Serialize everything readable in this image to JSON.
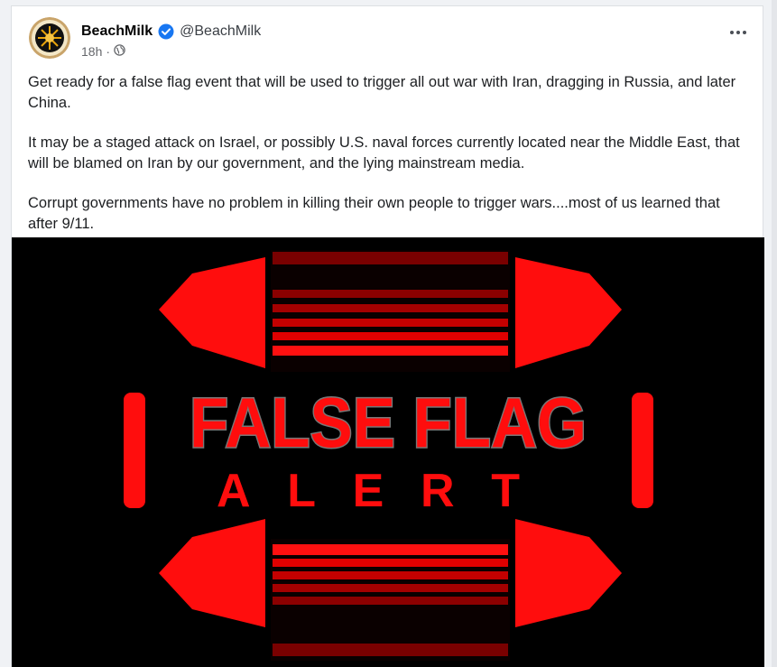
{
  "post": {
    "author": {
      "name": "BeachMilk",
      "handle": "@BeachMilk",
      "verified": true
    },
    "time": "18h",
    "separator": "·",
    "audience_icon": "globe-icon",
    "more_icon": "more-options-icon",
    "paragraphs": [
      "Get ready for a false flag event that will be used to trigger all out war with Iran, dragging in Russia, and later China.",
      "It may be a staged attack on Israel, or possibly U.S. naval forces currently located near the Middle East, that will be blamed on Iran by our government, and the lying mainstream media.",
      "Corrupt governments have no problem in killing their own people to trigger wars....most of us learned that after 9/11."
    ]
  },
  "image": {
    "headline": "FALSE FLAG",
    "subline": "ALERT",
    "background": "#000000",
    "accent": "#ff0d0d",
    "stripe_dark": "#8b0000"
  },
  "colors": {
    "verified": "#1877f2",
    "name_text": "#050505",
    "meta_text": "#65676b"
  }
}
